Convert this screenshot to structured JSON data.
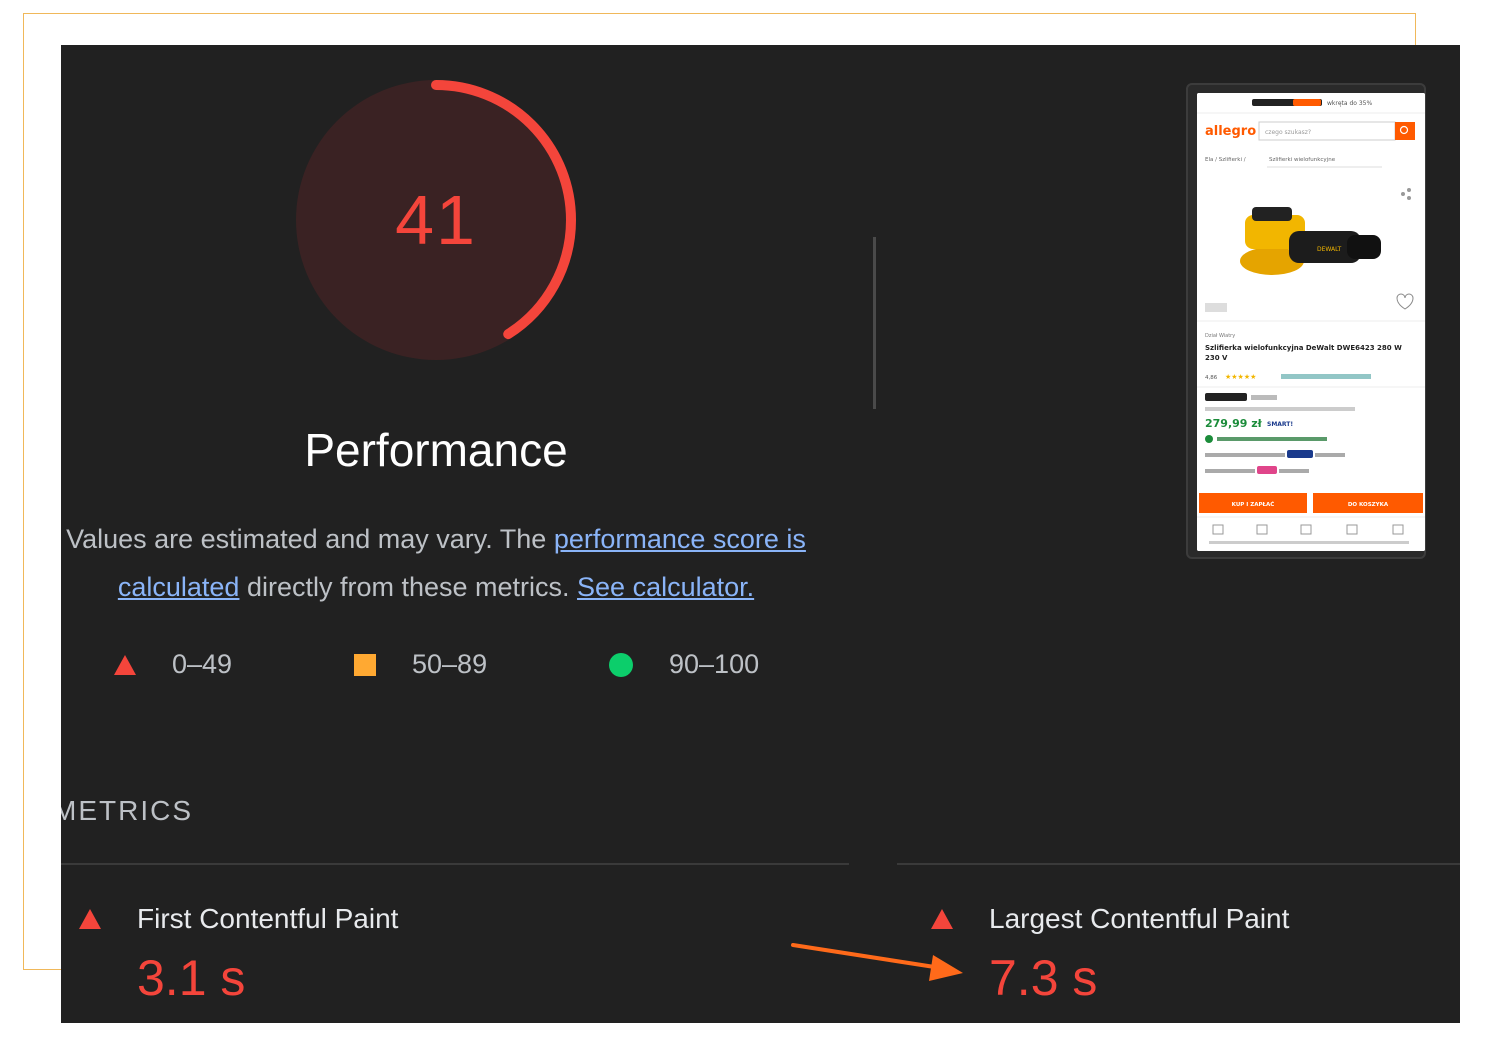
{
  "performance": {
    "score": "41",
    "score_fraction": 0.41,
    "title": "Performance",
    "description_parts": {
      "text1": "Values are estimated and may vary. The ",
      "link1": "performance score is calculated",
      "text2": " directly from these metrics. ",
      "link2": "See calculator."
    }
  },
  "legend": [
    {
      "shape": "triangle",
      "range": "0–49",
      "color": "#f4453b"
    },
    {
      "shape": "square",
      "range": "50–89",
      "color": "#ffa932"
    },
    {
      "shape": "circle",
      "range": "90–100",
      "color": "#0cce6b"
    }
  ],
  "metrics": {
    "section_title": "METRICS",
    "items": [
      {
        "label": "First Contentful Paint",
        "value": "3.1 s",
        "status": "fail"
      },
      {
        "label": "Largest Contentful Paint",
        "value": "7.3 s",
        "status": "fail"
      }
    ]
  },
  "screenshot": {
    "promo": "wkręta do 35%",
    "logo": "allegro",
    "search_placeholder": "czego szukasz?",
    "breadcrumb": "Szlifierki wielofunkcyjne",
    "product_title": "Szlifierka wielofunkcyjna DeWalt DWE6423 280 W 230 V",
    "rating": "4,86",
    "price": "279,99 zł",
    "smart": "SMART!",
    "buy_now": "KUP I ZAPŁAĆ",
    "add_to_cart": "DO KOSZYKA"
  },
  "colors": {
    "fail": "#f4453b",
    "average": "#ffa932",
    "pass": "#0cce6b",
    "link": "#8ab4f8",
    "background": "#212121",
    "allegro_orange": "#ff5a00"
  }
}
